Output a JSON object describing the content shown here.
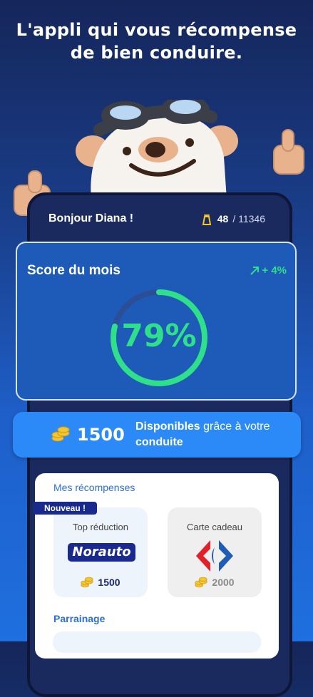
{
  "headline": {
    "line1": "L'appli qui vous récompense",
    "line2": "de bien conduire."
  },
  "header": {
    "greeting": "Bonjour Diana !",
    "rank": "48",
    "rank_total": "/ 11346",
    "rank_icon": "tower-icon"
  },
  "score": {
    "title": "Score du mois",
    "trend": "+ 4%",
    "trend_icon": "arrow-up-right-icon",
    "value": "79%",
    "percent": 79,
    "color": "#2fe08a"
  },
  "points": {
    "amount": "1500",
    "desc_prefix": "Disponibles",
    "desc_mid": " grâce à votre ",
    "desc_suffix": "conduite",
    "icon": "coins-icon"
  },
  "rewards": {
    "section_label": "Mes récompenses",
    "items": [
      {
        "badge": "Nouveau !",
        "title": "Top réduction",
        "brand": "Norauto",
        "cost": "1500"
      },
      {
        "title": "Carte cadeau",
        "brand": "Carrefour",
        "cost": "2000"
      }
    ]
  },
  "referral": {
    "section_label": "Parrainage"
  }
}
